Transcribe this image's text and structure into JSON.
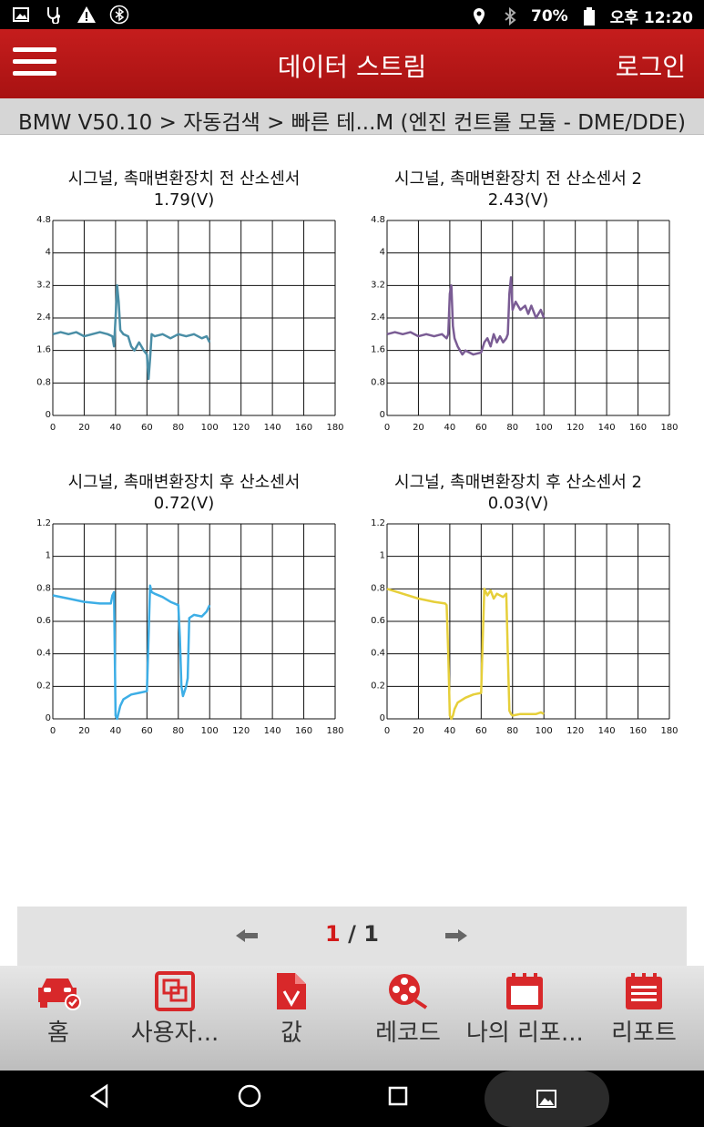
{
  "statusbar": {
    "battery": "70%",
    "time": "오후 12:20"
  },
  "appbar": {
    "title": "데이터 스트림",
    "login": "로그인"
  },
  "breadcrumb": "BMW V50.10 > 자동검색 > 빠른 테...M (엔진 컨트롤 모듈 - DME/DDE)",
  "charts": [
    {
      "title": "시그널, 촉매변환장치 전 산소센서",
      "value": "1.79(V)",
      "color": "#4a8ea6"
    },
    {
      "title": "시그널, 촉매변환장치 전 산소센서 2",
      "value": "2.43(V)",
      "color": "#7a5c94"
    },
    {
      "title": "시그널, 촉매변환장치 후 산소센서",
      "value": "0.72(V)",
      "color": "#3daee6"
    },
    {
      "title": "시그널, 촉매변환장치 후 산소센서 2",
      "value": "0.03(V)",
      "color": "#e6cf3a"
    }
  ],
  "chart_data": [
    {
      "type": "line",
      "ylim": [
        0,
        4.8
      ],
      "xlim": [
        0,
        180
      ],
      "yticks": [
        "0",
        "0.8",
        "1.6",
        "2.4",
        "3.2",
        "4",
        "4.8"
      ],
      "xticks": [
        "0",
        "20",
        "40",
        "60",
        "80",
        "100",
        "120",
        "140",
        "160",
        "180"
      ],
      "series": [
        {
          "x": [
            0,
            5,
            10,
            15,
            20,
            25,
            30,
            35,
            38,
            39,
            40,
            41,
            42,
            43,
            45,
            48,
            50,
            52,
            55,
            58,
            60,
            61,
            62,
            63,
            65,
            70,
            75,
            80,
            85,
            90,
            95,
            98,
            100
          ],
          "y": [
            2.0,
            2.05,
            2.0,
            2.05,
            1.95,
            2.0,
            2.05,
            2.0,
            1.95,
            1.7,
            2.4,
            3.2,
            2.8,
            2.1,
            2.0,
            1.95,
            1.7,
            1.6,
            1.8,
            1.6,
            1.5,
            0.9,
            1.4,
            2.0,
            1.95,
            2.0,
            1.9,
            2.0,
            1.95,
            2.0,
            1.9,
            1.95,
            1.8
          ]
        }
      ]
    },
    {
      "type": "line",
      "ylim": [
        0,
        4.8
      ],
      "xlim": [
        0,
        180
      ],
      "yticks": [
        "0",
        "0.8",
        "1.6",
        "2.4",
        "3.2",
        "4",
        "4.8"
      ],
      "xticks": [
        "0",
        "20",
        "40",
        "60",
        "80",
        "100",
        "120",
        "140",
        "160",
        "180"
      ],
      "series": [
        {
          "x": [
            0,
            5,
            10,
            15,
            20,
            25,
            30,
            35,
            38,
            39,
            40,
            41,
            42,
            43,
            45,
            48,
            50,
            55,
            60,
            62,
            64,
            66,
            68,
            70,
            72,
            74,
            76,
            77,
            78,
            79,
            80,
            82,
            85,
            88,
            90,
            92,
            95,
            98,
            100
          ],
          "y": [
            2.0,
            2.05,
            2.0,
            2.05,
            1.95,
            2.0,
            1.95,
            2.0,
            1.9,
            2.0,
            3.0,
            3.2,
            2.2,
            1.9,
            1.7,
            1.5,
            1.6,
            1.5,
            1.55,
            1.8,
            1.9,
            1.7,
            2.0,
            1.8,
            1.95,
            1.8,
            1.9,
            2.0,
            3.0,
            3.4,
            2.6,
            2.8,
            2.6,
            2.7,
            2.5,
            2.7,
            2.4,
            2.6,
            2.4
          ]
        }
      ]
    },
    {
      "type": "line",
      "ylim": [
        0,
        1.2
      ],
      "xlim": [
        0,
        180
      ],
      "yticks": [
        "0",
        "0.2",
        "0.4",
        "0.6",
        "0.8",
        "1",
        "1.2"
      ],
      "xticks": [
        "0",
        "20",
        "40",
        "60",
        "80",
        "100",
        "120",
        "140",
        "160",
        "180"
      ],
      "series": [
        {
          "x": [
            0,
            10,
            20,
            30,
            37,
            38,
            39,
            40,
            41,
            42,
            43,
            45,
            50,
            55,
            60,
            61,
            62,
            63,
            65,
            70,
            75,
            80,
            81,
            82,
            83,
            85,
            86,
            87,
            90,
            95,
            98,
            100
          ],
          "y": [
            0.76,
            0.74,
            0.72,
            0.71,
            0.71,
            0.76,
            0.78,
            0.02,
            0.0,
            0.04,
            0.08,
            0.12,
            0.15,
            0.16,
            0.17,
            0.5,
            0.82,
            0.78,
            0.77,
            0.75,
            0.72,
            0.7,
            0.5,
            0.2,
            0.14,
            0.2,
            0.25,
            0.62,
            0.64,
            0.63,
            0.66,
            0.7
          ]
        }
      ]
    },
    {
      "type": "line",
      "ylim": [
        0,
        1.2
      ],
      "xlim": [
        0,
        180
      ],
      "yticks": [
        "0",
        "0.2",
        "0.4",
        "0.6",
        "0.8",
        "1",
        "1.2"
      ],
      "xticks": [
        "0",
        "20",
        "40",
        "60",
        "80",
        "100",
        "120",
        "140",
        "160",
        "180"
      ],
      "series": [
        {
          "x": [
            0,
            10,
            20,
            30,
            37,
            38,
            39,
            40,
            41,
            42,
            43,
            45,
            50,
            55,
            60,
            61,
            62,
            64,
            66,
            68,
            70,
            74,
            76,
            77,
            78,
            79,
            80,
            85,
            90,
            95,
            98,
            100
          ],
          "y": [
            0.8,
            0.77,
            0.74,
            0.72,
            0.71,
            0.7,
            0.4,
            0.02,
            0.0,
            0.02,
            0.06,
            0.1,
            0.13,
            0.15,
            0.16,
            0.5,
            0.8,
            0.76,
            0.79,
            0.74,
            0.77,
            0.75,
            0.77,
            0.4,
            0.05,
            0.03,
            0.02,
            0.03,
            0.03,
            0.03,
            0.04,
            0.03
          ]
        }
      ]
    }
  ],
  "pager": {
    "current": "1",
    "total": " / 1"
  },
  "nav": [
    {
      "label": "홈",
      "icon": "car-check-icon"
    },
    {
      "label": "사용자...",
      "icon": "user-select-icon"
    },
    {
      "label": "값",
      "icon": "value-doc-icon"
    },
    {
      "label": "레코드",
      "icon": "film-reel-icon"
    },
    {
      "label": "나의 리포...",
      "icon": "my-report-icon"
    },
    {
      "label": "리포트",
      "icon": "report-list-icon"
    }
  ]
}
